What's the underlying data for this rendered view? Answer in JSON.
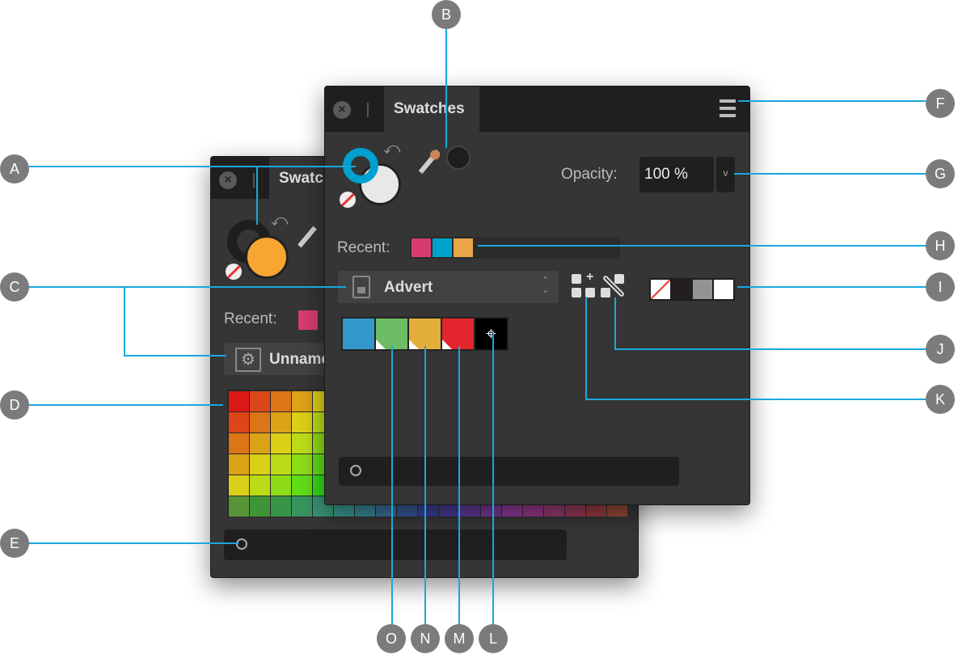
{
  "back_panel": {
    "tab_title": "Swatches",
    "recent_label": "Recent:",
    "palette_name": "Unnamed",
    "search_placeholder": ""
  },
  "front_panel": {
    "tab_title": "Swatches",
    "opacity_label": "Opacity:",
    "opacity_value": "100 %",
    "recent_label": "Recent:",
    "recent_colors": [
      "#d63d6e",
      "#00a3cc",
      "#eaa548"
    ],
    "palette_name": "Advert",
    "palette_swatches": [
      "#3399cc",
      "#6cbd63",
      "#e3ad3a",
      "#e3262e",
      "#000000"
    ],
    "quick_colors": [
      "none",
      "#231f20",
      "#939393",
      "#ffffff"
    ],
    "fill_color": "#e8e8e8",
    "stroke_color": "#00a0cf",
    "search_placeholder": ""
  },
  "accent_color": "#1aa7dc",
  "callouts": [
    "A",
    "B",
    "C",
    "D",
    "E",
    "F",
    "G",
    "H",
    "I",
    "J",
    "K",
    "L",
    "M",
    "N",
    "O"
  ]
}
